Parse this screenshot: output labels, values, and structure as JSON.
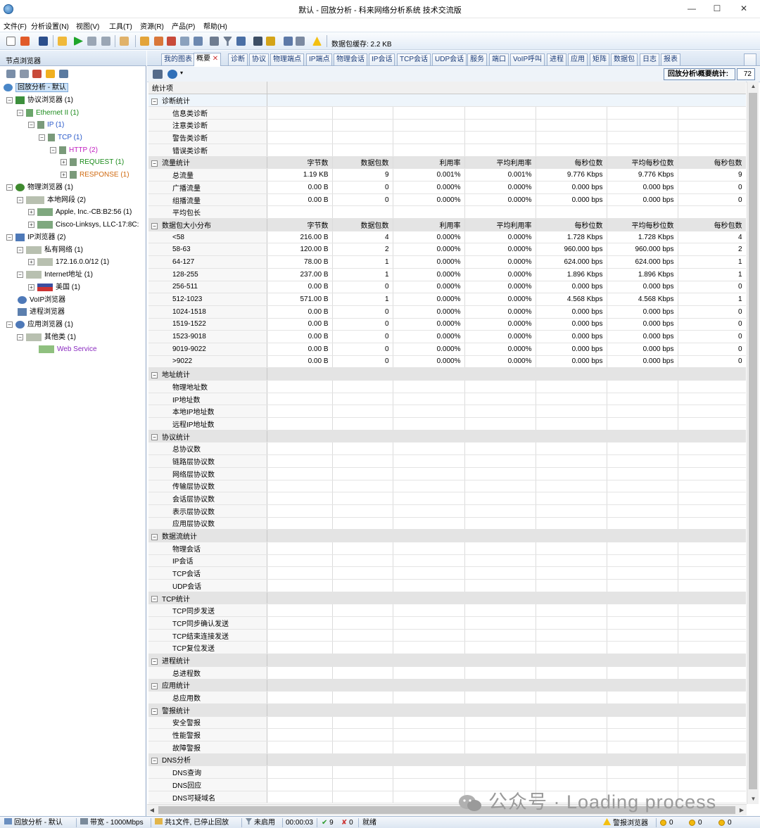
{
  "window": {
    "title": "默认 - 回放分析 - 科来网络分析系统 技术交流版",
    "minimize": "—",
    "maximize": "☐",
    "close": "✕"
  },
  "menu": [
    "文件(F)",
    "分析设置(N)",
    "视图(V)",
    "工具(T)",
    "资源(R)",
    "产品(P)",
    "帮助(H)"
  ],
  "toolbar": {
    "cache_label": "数据包缓存: 2.2 KB"
  },
  "node_browser": {
    "title": "节点浏览器",
    "nodes": [
      {
        "label": "回放分析 - 默认"
      },
      {
        "label": "协议浏览器 (1)"
      },
      {
        "label": "Ethernet II (1)"
      },
      {
        "label": "IP (1)"
      },
      {
        "label": "TCP (1)"
      },
      {
        "label": "HTTP (2)"
      },
      {
        "label": "REQUEST (1)"
      },
      {
        "label": "RESPONSE (1)"
      },
      {
        "label": "物理浏览器 (1)"
      },
      {
        "label": "本地网段 (2)"
      },
      {
        "label": "Apple, Inc.-CB:B2:56 (1)"
      },
      {
        "label": "Cisco-Linksys, LLC-17:8C:"
      },
      {
        "label": "IP浏览器 (2)"
      },
      {
        "label": "私有网络 (1)"
      },
      {
        "label": "172.16.0.0/12 (1)"
      },
      {
        "label": "Internet地址 (1)"
      },
      {
        "label": "美国 (1)"
      },
      {
        "label": "VoIP浏览器"
      },
      {
        "label": "进程浏览器"
      },
      {
        "label": "应用浏览器 (1)"
      },
      {
        "label": "其他类 (1)"
      },
      {
        "label": "Web Service"
      }
    ]
  },
  "tabs": [
    "我的图表",
    "概要",
    "诊断",
    "协议",
    "物理端点",
    "IP端点",
    "物理会话",
    "IP会话",
    "TCP会话",
    "UDP会话",
    "服务",
    "端口",
    "VoIP呼叫",
    "进程",
    "应用",
    "矩阵",
    "数据包",
    "日志",
    "报表"
  ],
  "summary": {
    "stat_label": "回放分析\\概要统计:",
    "stat_count": "72",
    "column_header": "统计项",
    "columns": [
      "字节数",
      "数据包数",
      "利用率",
      "平均利用率",
      "每秒位数",
      "平均每秒位数",
      "每秒包数"
    ],
    "sections": [
      {
        "title": "诊断统计",
        "items": [
          {
            "name": "信息类诊断"
          },
          {
            "name": "注意类诊断"
          },
          {
            "name": "警告类诊断"
          },
          {
            "name": "错误类诊断"
          }
        ]
      },
      {
        "title": "流量统计",
        "show_columns": true,
        "items": [
          {
            "name": "总流量",
            "cells": [
              "1.19 KB",
              "9",
              "0.001%",
              "0.001%",
              "9.776 Kbps",
              "9.776 Kbps",
              "9"
            ]
          },
          {
            "name": "广播流量",
            "cells": [
              "0.00 B",
              "0",
              "0.000%",
              "0.000%",
              "0.000 bps",
              "0.000 bps",
              "0"
            ]
          },
          {
            "name": "组播流量",
            "cells": [
              "0.00 B",
              "0",
              "0.000%",
              "0.000%",
              "0.000 bps",
              "0.000 bps",
              "0"
            ]
          },
          {
            "name": "平均包长"
          }
        ]
      },
      {
        "title": "数据包大小分布",
        "show_columns": true,
        "items": [
          {
            "name": "<58",
            "cells": [
              "216.00 B",
              "4",
              "0.000%",
              "0.000%",
              "1.728 Kbps",
              "1.728 Kbps",
              "4"
            ]
          },
          {
            "name": "58-63",
            "cells": [
              "120.00 B",
              "2",
              "0.000%",
              "0.000%",
              "960.000 bps",
              "960.000 bps",
              "2"
            ]
          },
          {
            "name": "64-127",
            "cells": [
              "78.00 B",
              "1",
              "0.000%",
              "0.000%",
              "624.000 bps",
              "624.000 bps",
              "1"
            ]
          },
          {
            "name": "128-255",
            "cells": [
              "237.00 B",
              "1",
              "0.000%",
              "0.000%",
              "1.896 Kbps",
              "1.896 Kbps",
              "1"
            ]
          },
          {
            "name": "256-511",
            "cells": [
              "0.00 B",
              "0",
              "0.000%",
              "0.000%",
              "0.000 bps",
              "0.000 bps",
              "0"
            ]
          },
          {
            "name": "512-1023",
            "cells": [
              "571.00 B",
              "1",
              "0.000%",
              "0.000%",
              "4.568 Kbps",
              "4.568 Kbps",
              "1"
            ]
          },
          {
            "name": "1024-1518",
            "cells": [
              "0.00 B",
              "0",
              "0.000%",
              "0.000%",
              "0.000 bps",
              "0.000 bps",
              "0"
            ]
          },
          {
            "name": "1519-1522",
            "cells": [
              "0.00 B",
              "0",
              "0.000%",
              "0.000%",
              "0.000 bps",
              "0.000 bps",
              "0"
            ]
          },
          {
            "name": "1523-9018",
            "cells": [
              "0.00 B",
              "0",
              "0.000%",
              "0.000%",
              "0.000 bps",
              "0.000 bps",
              "0"
            ]
          },
          {
            "name": "9019-9022",
            "cells": [
              "0.00 B",
              "0",
              "0.000%",
              "0.000%",
              "0.000 bps",
              "0.000 bps",
              "0"
            ]
          },
          {
            "name": ">9022",
            "cells": [
              "0.00 B",
              "0",
              "0.000%",
              "0.000%",
              "0.000 bps",
              "0.000 bps",
              "0"
            ]
          }
        ]
      },
      {
        "title": "地址统计",
        "items": [
          {
            "name": "物理地址数"
          },
          {
            "name": "IP地址数"
          },
          {
            "name": "本地IP地址数"
          },
          {
            "name": "远程IP地址数"
          }
        ]
      },
      {
        "title": "协议统计",
        "items": [
          {
            "name": "总协议数"
          },
          {
            "name": "链路层协议数"
          },
          {
            "name": "网络层协议数"
          },
          {
            "name": "传输层协议数"
          },
          {
            "name": "会话层协议数"
          },
          {
            "name": "表示层协议数"
          },
          {
            "name": "应用层协议数"
          }
        ]
      },
      {
        "title": "数据流统计",
        "items": [
          {
            "name": "物理会话"
          },
          {
            "name": "IP会话"
          },
          {
            "name": "TCP会话"
          },
          {
            "name": "UDP会话"
          }
        ]
      },
      {
        "title": "TCP统计",
        "items": [
          {
            "name": "TCP同步发送"
          },
          {
            "name": "TCP同步确认发送"
          },
          {
            "name": "TCP结束连接发送"
          },
          {
            "name": "TCP复位发送"
          }
        ]
      },
      {
        "title": "进程统计",
        "items": [
          {
            "name": "总进程数"
          }
        ]
      },
      {
        "title": "应用统计",
        "items": [
          {
            "name": "总应用数"
          }
        ]
      },
      {
        "title": "警报统计",
        "items": [
          {
            "name": "安全警报"
          },
          {
            "name": "性能警报"
          },
          {
            "name": "故障警报"
          }
        ]
      },
      {
        "title": "DNS分析",
        "items": [
          {
            "name": "DNS查询"
          },
          {
            "name": "DNS回应"
          },
          {
            "name": "DNS可疑域名"
          }
        ]
      }
    ]
  },
  "watermark": "公众号 · Loading process",
  "status": {
    "mode": "回放分析 - 默认",
    "bandwidth": "带宽 - 1000Mbps",
    "files": "共1文件, 已停止回放",
    "filter": "未启用",
    "elapsed": "00:00:03",
    "ok_count": "9",
    "err_count": "0",
    "ready": "就绪",
    "alert_browser": "警报浏览器",
    "alert_counts": [
      "0",
      "0",
      "0"
    ]
  },
  "colors": {
    "accent": "#2a6fb5",
    "tree_green": "#1a8a1a",
    "tree_blue": "#2556c9",
    "tree_magenta": "#c01fc0",
    "tree_orange": "#d06a10",
    "tree_purple": "#8a2ac0"
  }
}
